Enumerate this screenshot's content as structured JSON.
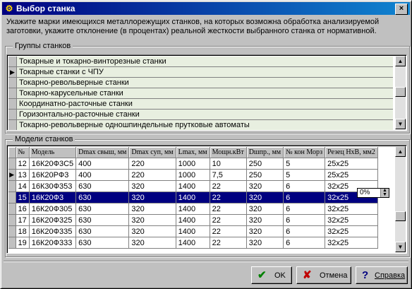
{
  "window": {
    "title": "Выбор станка",
    "close_label": "×"
  },
  "instruction": "Укажите марки имеющихся металлорежущих станков, на которых возможна обработка анализируемой заготовки, укажите отклонение (в процентах) реальной жесткости выбранного станка от нормативной.",
  "groups": {
    "label": "Группы станков",
    "current_index": 1,
    "items": [
      "Токарные и токарно-винторезные станки",
      "Токарные станки  с ЧПУ",
      "Токарно-револьверные станки",
      "Токарно-карусельные станки",
      "Координатно-расточные станки",
      "Горизонтально-расточные станки",
      "Токарно-револьверные одношпиндельные прутковые автоматы"
    ]
  },
  "models": {
    "label": "Модели станков",
    "columns": [
      "№",
      "Модель",
      "Dmax свыш, мм",
      "Dmax суп, мм",
      "Lmax, мм",
      "Мощн.кВт",
      "Dшпр., мм",
      "№ кон Морз",
      "Резец НхВ, мм2"
    ],
    "selected_row": 3,
    "current_row": 1,
    "rows": [
      [
        "12",
        "16К20Ф3С5",
        "400",
        "220",
        "1000",
        "10",
        "250",
        "5",
        "25x25"
      ],
      [
        "13",
        "16К20РФ3",
        "400",
        "220",
        "1000",
        "7,5",
        "250",
        "5",
        "25x25"
      ],
      [
        "14",
        "16К30Ф353",
        "630",
        "320",
        "1400",
        "22",
        "320",
        "6",
        "32x25"
      ],
      [
        "15",
        "16К20Ф3",
        "630",
        "320",
        "1400",
        "22",
        "320",
        "6",
        "32x25"
      ],
      [
        "16",
        "16К20Ф305",
        "630",
        "320",
        "1400",
        "22",
        "320",
        "6",
        "32x25"
      ],
      [
        "17",
        "16К20Ф325",
        "630",
        "320",
        "1400",
        "22",
        "320",
        "6",
        "32x25"
      ],
      [
        "18",
        "16К20Ф335",
        "630",
        "320",
        "1400",
        "22",
        "320",
        "6",
        "32x25"
      ],
      [
        "19",
        "16К20Ф333",
        "630",
        "320",
        "1400",
        "22",
        "320",
        "6",
        "32x25"
      ]
    ],
    "deviation_value": "0%"
  },
  "buttons": {
    "ok": "OK",
    "cancel": "Отмена",
    "help": "Справка"
  },
  "colors": {
    "titlebar": "#000080",
    "selection": "#000080",
    "group_row_bg": "#e8efe0"
  },
  "icons": {
    "window": "machine-icon",
    "ok": "checkmark-icon",
    "cancel": "x-icon",
    "help": "question-mark-icon"
  }
}
